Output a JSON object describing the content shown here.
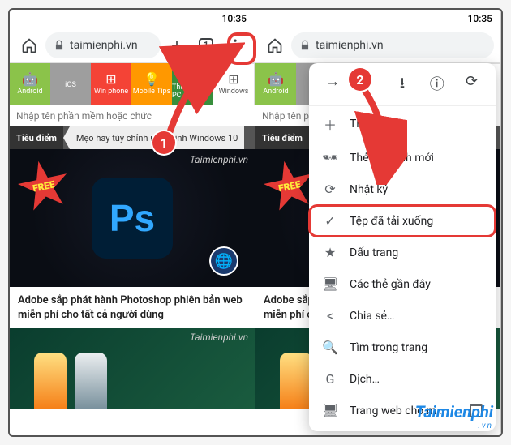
{
  "status": {
    "time": "10:35"
  },
  "toolbar": {
    "url": "taimienphi.vn",
    "tab_count": "1"
  },
  "nav": {
    "items": [
      {
        "label": "Android",
        "icon": "🤖",
        "cls": "bg-green"
      },
      {
        "label": "iOS",
        "icon": "",
        "cls": "bg-grey"
      },
      {
        "label": "Win phone",
        "icon": "⊞",
        "cls": "bg-red"
      },
      {
        "label": "Mobile Tips",
        "icon": "💡",
        "cls": "bg-orange"
      },
      {
        "label": "Thủ thuật PC",
        "icon": "🖥",
        "cls": "bg-dgreen"
      },
      {
        "label": "Windows",
        "icon": "⊞",
        "cls": "bg-white"
      }
    ]
  },
  "search": {
    "placeholder": "Nhập tên phần mềm hoặc chức"
  },
  "crumb": {
    "c1": "Tiêu điểm",
    "c2": "Mẹo hay tùy chỉnh màn hình Windows 10"
  },
  "article1": {
    "free": "FREE",
    "ps": "Ps",
    "wm": "Taimienphi.vn",
    "headline": "Adobe sắp phát hành Photoshop phiên bản web miễn phí cho tất cả người dùng"
  },
  "article2": {
    "wm": "Taimienphi.vn"
  },
  "menu": {
    "items": [
      {
        "icon": "＋",
        "label": "Thẻ mới"
      },
      {
        "icon": "🕶",
        "label": "Thẻ ẩn danh mới"
      },
      {
        "icon": "⟳",
        "label": "Nhật ký"
      },
      {
        "icon": "✓",
        "label": "Tệp đã tải xuống",
        "hl": true
      },
      {
        "icon": "★",
        "label": "Dấu trang"
      },
      {
        "icon": "🖥",
        "label": "Các thẻ gần đây"
      },
      {
        "icon": "<",
        "label": "Chia sẻ…"
      },
      {
        "icon": "🔍",
        "label": "Tìm trong trang"
      },
      {
        "icon": "G",
        "label": "Dịch…"
      },
      {
        "icon": "🖥",
        "label": "Trang web cho m…",
        "checkbox": true
      }
    ]
  },
  "annot": {
    "n1": "1",
    "n2": "2"
  },
  "brand": {
    "name": "Taimienphi",
    "tld": ".vn"
  }
}
